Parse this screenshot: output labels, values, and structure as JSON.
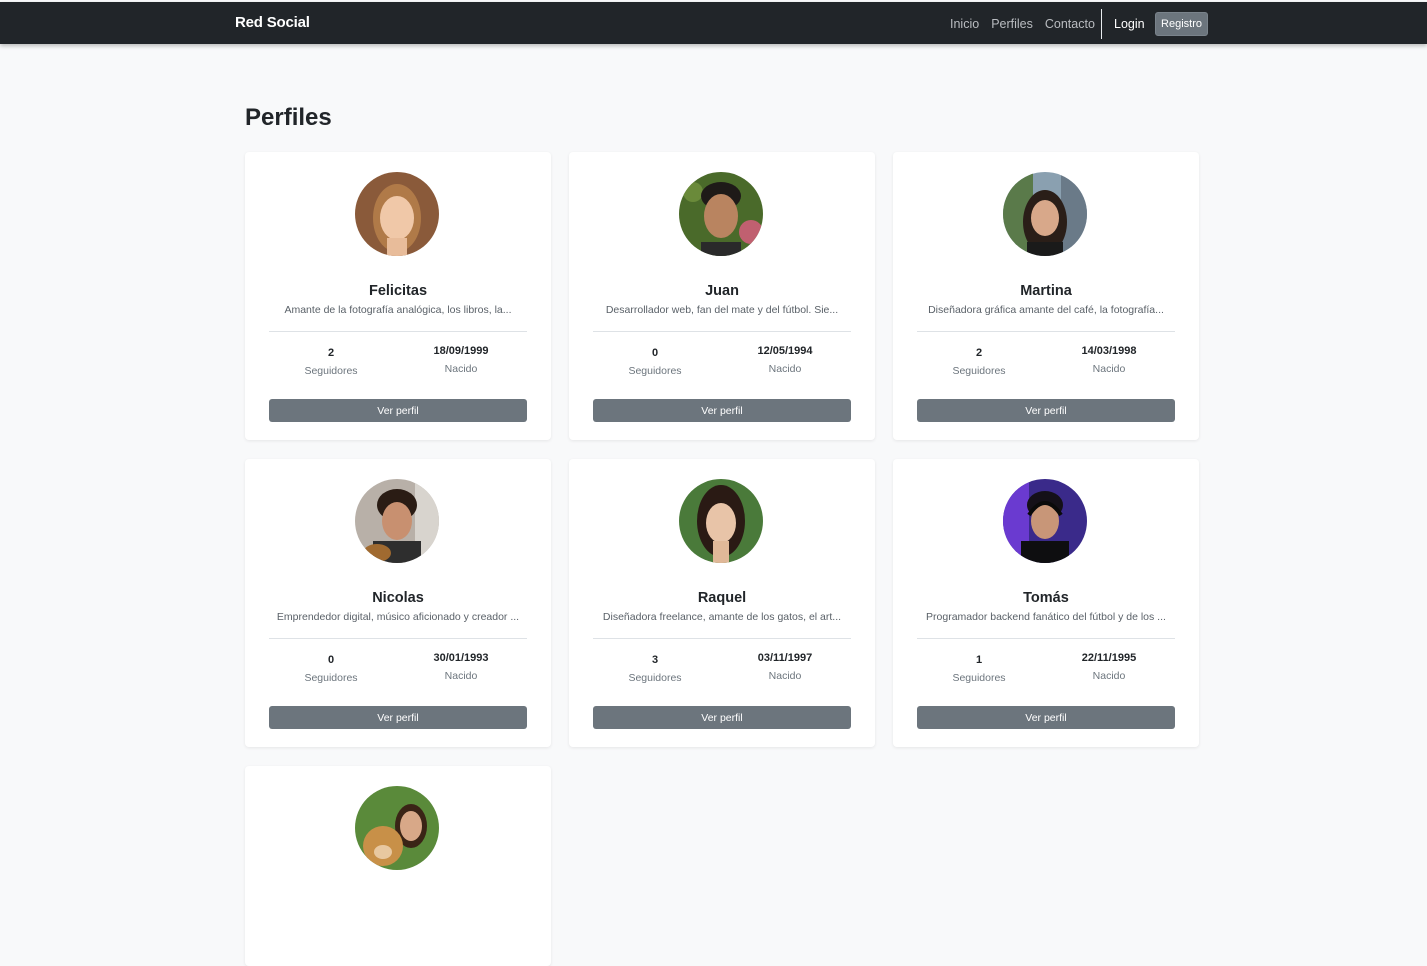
{
  "navbar": {
    "brand": "Red Social",
    "links": [
      "Inicio",
      "Perfiles",
      "Contacto"
    ],
    "login": "Login",
    "registro": "Registro"
  },
  "page_title": "Perfiles",
  "labels": {
    "followers": "Seguidores",
    "born": "Nacido",
    "view_profile": "Ver perfil"
  },
  "profiles": [
    {
      "name": "Felicitas",
      "bio": "Amante de la fotografía analógica, los libros, la...",
      "followers": "2",
      "birth": "18/09/1999"
    },
    {
      "name": "Juan",
      "bio": "Desarrollador web, fan del mate y del fútbol. Sie...",
      "followers": "0",
      "birth": "12/05/1994"
    },
    {
      "name": "Martina",
      "bio": "Diseñadora gráfica amante del café, la fotografía...",
      "followers": "2",
      "birth": "14/03/1998"
    },
    {
      "name": "Nicolas",
      "bio": "Emprendedor digital, músico aficionado y creador ...",
      "followers": "0",
      "birth": "30/01/1993"
    },
    {
      "name": "Raquel",
      "bio": "Diseñadora freelance, amante de los gatos, el art...",
      "followers": "3",
      "birth": "03/11/1997"
    },
    {
      "name": "Tomás",
      "bio": "Programador backend fanático del fútbol y de los ...",
      "followers": "1",
      "birth": "22/11/1995"
    }
  ],
  "colors": {
    "navbar": "#212529",
    "button": "#6c757d",
    "background": "#f8f9fa"
  }
}
